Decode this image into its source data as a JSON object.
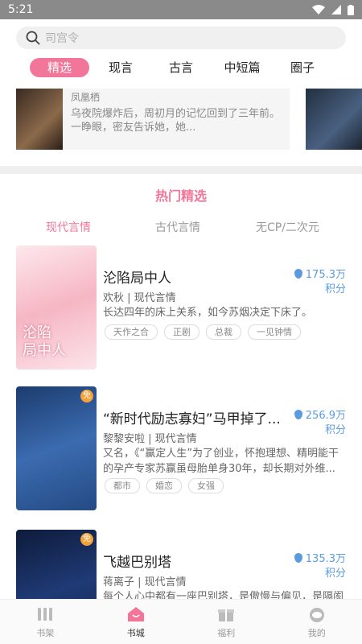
{
  "status": {
    "time": "5:21"
  },
  "search": {
    "placeholder": "司宫令"
  },
  "tabs": [
    {
      "label": "精选"
    },
    {
      "label": "现言"
    },
    {
      "label": "古言"
    },
    {
      "label": "中短篇"
    },
    {
      "label": "圈子"
    }
  ],
  "banner": {
    "author": "凤凰栖",
    "desc": "乌夜院爆炸后，周初月的记忆回到了三年前。一睁眼，密友告诉她，她..."
  },
  "section": {
    "title": "热门精选"
  },
  "subtabs": [
    {
      "label": "现代言情"
    },
    {
      "label": "古代言情"
    },
    {
      "label": "无CP/二次元"
    }
  ],
  "books": [
    {
      "title": "沦陷局中人",
      "author": "欢秋",
      "category": "现代言情",
      "summary": "长达四年的床上关系，如今苏烟决定下床了。",
      "tags": [
        "天作之合",
        "正剧",
        "总裁",
        "一见钟情"
      ],
      "points": "175.3万",
      "points_unit": "积分",
      "cover_text": "沦陷\n局中人"
    },
    {
      "title": "“新时代励志寡妇”马甲掉了...",
      "author": "黎黎安啦",
      "category": "现代言情",
      "summary": "又名，《“赢定人生”为了创业，怀抱理想、精明能干的孕产专家苏赢虽母胎单身30年，却长期对外维...",
      "tags": [
        "都市",
        "婚恋",
        "女强"
      ],
      "points": "256.9万",
      "points_unit": "积分",
      "badge": "免"
    },
    {
      "title": "飞越巴别塔",
      "author": "蒋离子",
      "category": "现代言情",
      "summary": "每个人心中都有一座巴别塔，是傲慢与偏见，是隔阂",
      "tags": [],
      "points": "135.3万",
      "points_unit": "积分",
      "badge": "免"
    }
  ],
  "bottomnav": [
    {
      "label": "书架",
      "icon": "bookshelf-icon"
    },
    {
      "label": "书城",
      "icon": "store-icon"
    },
    {
      "label": "福利",
      "icon": "gift-icon"
    },
    {
      "label": "我的",
      "icon": "profile-icon"
    }
  ],
  "colors": {
    "accent": "#f2769a",
    "points": "#5a9be0"
  }
}
